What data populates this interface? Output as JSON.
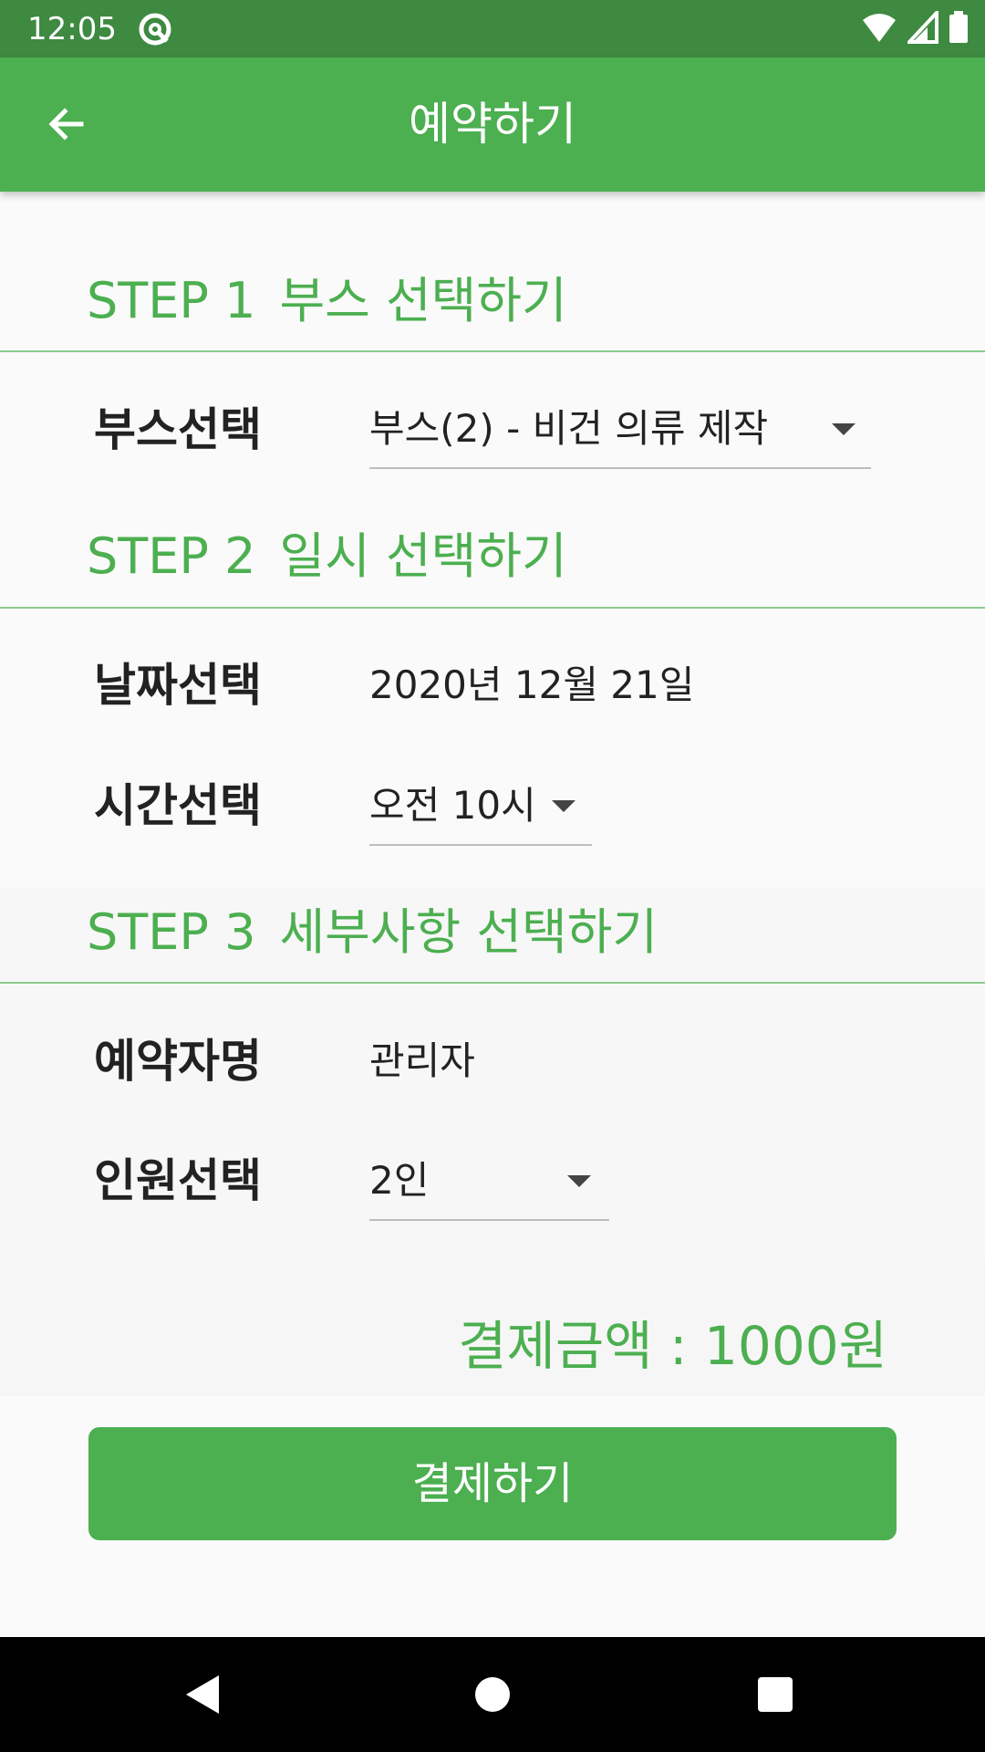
{
  "status_bar": {
    "time": "12:05",
    "app_icon": "at-sign-icon",
    "icons": [
      "wifi-icon",
      "signal-icon",
      "battery-icon"
    ]
  },
  "app_bar": {
    "title": "예약하기",
    "back_icon": "arrow-left-icon"
  },
  "steps": [
    {
      "step": "STEP 1",
      "title": "부스 선택하기"
    },
    {
      "step": "STEP 2",
      "title": "일시 선택하기"
    },
    {
      "step": "STEP 3",
      "title": "세부사항 선택하기"
    }
  ],
  "fields": {
    "booth": {
      "label": "부스선택",
      "value": "부스(2) - 비건 의류 제작"
    },
    "date": {
      "label": "날짜선택",
      "value": "2020년 12월 21일"
    },
    "time": {
      "label": "시간선택",
      "value": "오전 10시"
    },
    "name": {
      "label": "예약자명",
      "value": "관리자"
    },
    "people": {
      "label": "인원선택",
      "value": "2인"
    }
  },
  "total": "결제금액 : 1000원",
  "pay_button": "결제하기",
  "nav_bar": {
    "icons": [
      "back-triangle-icon",
      "home-circle-icon",
      "recents-square-icon"
    ]
  },
  "colors": {
    "status_bar": "#3d8a40",
    "primary": "#4caf50",
    "divider": "#8ccb8e",
    "background": "#fafafa"
  }
}
